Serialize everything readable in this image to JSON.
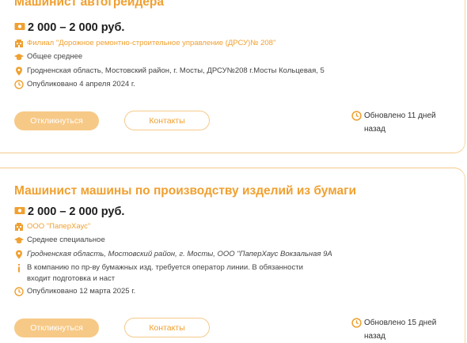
{
  "colors": {
    "accent": "#f0a030",
    "button_fill": "#f7c987",
    "border": "#f5c98a"
  },
  "vacancies": [
    {
      "title": "Машинист автогрейдера",
      "salary": "2 000 – 2 000 руб.",
      "employer": "Филиал \"Дорожное ремонтно-строительное управление (ДРСУ)№ 208\"",
      "education": "Общее среднее",
      "address": "Гродненская область, Мостовский район, г. Мосты, ДРСУ№208 г.Мосты Кольцевая, 5",
      "published": "Опубликовано 4 апреля 2024 г.",
      "apply_label": "Откликнуться",
      "contacts_label": "Контакты",
      "updated": "Обновлено 11 дней назад"
    },
    {
      "title": "Машинист машины по производству изделий из бумаги",
      "salary": "2 000 – 2 000 руб.",
      "employer": "ООО \"ПаперХаус\"",
      "education": "Среднее специальное",
      "address": "Гродненская область, Мостовский район, г. Мосты, ООО \"ПаперХаус Вокзальная 9А",
      "description": "В компанию по пр-ву бумажных изд. требуется оператор линии. В обязанности входит подготовка и наст",
      "published": "Опубликовано 12 марта 2025 г.",
      "apply_label": "Откликнуться",
      "contacts_label": "Контакты",
      "updated": "Обновлено 15 дней назад"
    }
  ],
  "icons": {
    "salary": "money-icon",
    "employer": "building-icon",
    "education": "graduation-cap-icon",
    "address": "location-pin-icon",
    "description": "info-icon",
    "published": "clock-icon",
    "updated": "clock-icon"
  }
}
